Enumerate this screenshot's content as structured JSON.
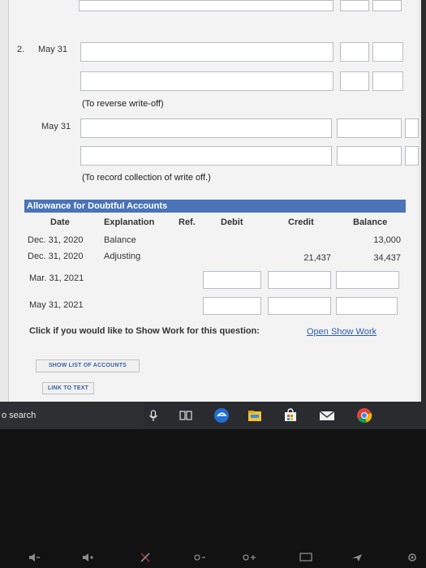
{
  "entry2": {
    "number": "2.",
    "date1": "May 31",
    "note1": "(To reverse write-off)",
    "date2": "May 31",
    "note2": "(To record collection of write off.)"
  },
  "ledger": {
    "title": "Allowance for Doubtful Accounts",
    "columns": [
      "Date",
      "Explanation",
      "Ref.",
      "Debit",
      "Credit",
      "Balance"
    ],
    "rows": [
      {
        "date": "Dec. 31, 2020",
        "explanation": "Balance",
        "credit": "",
        "balance": "13,000"
      },
      {
        "date": "Dec. 31, 2020",
        "explanation": "Adjusting",
        "credit": "21,437",
        "balance": "34,437"
      },
      {
        "date": "Mar. 31, 2021",
        "explanation": "",
        "credit": "",
        "balance": ""
      },
      {
        "date": "May 31, 2021",
        "explanation": "",
        "credit": "",
        "balance": ""
      }
    ]
  },
  "show_work": {
    "prompt": "Click if you would like to Show Work for this question:",
    "link": "Open Show Work"
  },
  "buttons": {
    "list_accounts": "SHOW LIST OF ACCOUNTS",
    "link_to_text": "LINK TO TEXT"
  },
  "taskbar": {
    "search_text": "o search"
  },
  "colors": {
    "header_blue": "#4a73b8",
    "link_blue": "#2d5db0"
  }
}
